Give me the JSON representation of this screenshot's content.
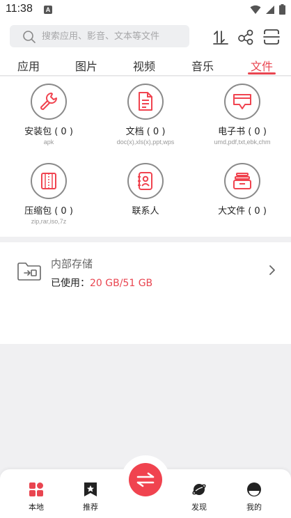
{
  "status_bar": {
    "time": "11:38",
    "notification_glyph": "A"
  },
  "search": {
    "placeholder": "搜索应用、影音、文本等文件"
  },
  "tabs": [
    {
      "label": "应用"
    },
    {
      "label": "图片"
    },
    {
      "label": "视频"
    },
    {
      "label": "音乐"
    },
    {
      "label": "文件",
      "active": true
    }
  ],
  "categories": [
    {
      "label": "安装包 ( 0 )",
      "sub": "apk",
      "icon": "wrench-icon"
    },
    {
      "label": "文档 ( 0 )",
      "sub": "doc(x),xls(x),ppt,wps",
      "icon": "document-icon"
    },
    {
      "label": "电子书 ( 0 )",
      "sub": "umd,pdf,txt,ebk,chm",
      "icon": "ebook-icon"
    },
    {
      "label": "压缩包 ( 0 )",
      "sub": "zip,rar,iso,7z",
      "icon": "archive-icon"
    },
    {
      "label": "联系人",
      "sub": "",
      "icon": "contact-icon"
    },
    {
      "label": "大文件 ( 0 )",
      "sub": "",
      "icon": "large-file-icon"
    }
  ],
  "storage": {
    "title": "内部存储",
    "usage_label": "已使用：",
    "usage_value": "20 GB/51 GB"
  },
  "bottom_nav": [
    {
      "label": "本地",
      "icon": "local-grid-icon"
    },
    {
      "label": "推荐",
      "icon": "star-bookmark-icon"
    },
    {
      "label": "发现",
      "icon": "planet-icon"
    },
    {
      "label": "我的",
      "icon": "profile-icon"
    }
  ],
  "colors": {
    "accent": "#e94550",
    "icon_red": "#f0434f",
    "icon_gray": "#8a8a8a",
    "background": "#f0f0f2"
  }
}
